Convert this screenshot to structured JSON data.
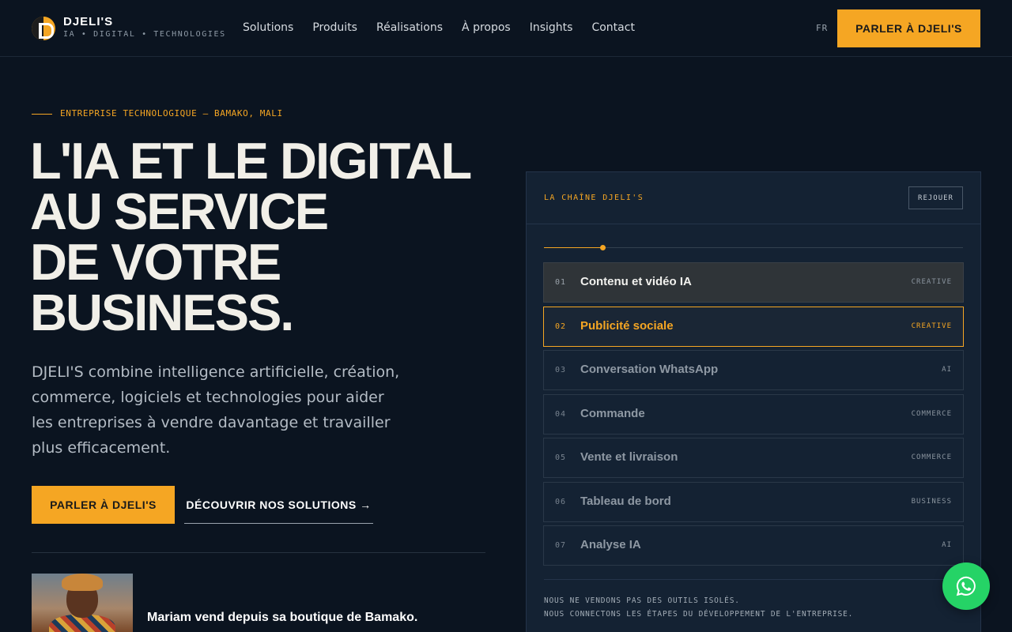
{
  "header": {
    "brand_name": "DJELI'S",
    "brand_tagline": "IA • DIGITAL • TECHNOLOGIES",
    "nav": [
      "Solutions",
      "Produits",
      "Réalisations",
      "À propos",
      "Insights",
      "Contact"
    ],
    "lang": "FR",
    "cta_label": "PARLER À DJELI'S"
  },
  "hero": {
    "eyebrow": "ENTREPRISE TECHNOLOGIQUE — BAMAKO, MALI",
    "title_lines": [
      "L'IA ET LE DIGITAL",
      "AU SERVICE",
      "DE VOTRE",
      "BUSINESS."
    ],
    "description": "DJELI'S combine intelligence artificielle, création, commerce, logiciels et technologies pour aider les entreprises à vendre davantage et travailler plus efficacement.",
    "primary_cta": "PARLER À DJELI'S",
    "secondary_cta": "DÉCOUVRIR NOS SOLUTIONS →",
    "testimonial": "Mariam vend depuis sa boutique de Bamako."
  },
  "chain": {
    "title": "LA CHAÎNE DJELI'S",
    "replay_label": "REJOUER",
    "progress": 0.14,
    "steps": [
      {
        "num": "01",
        "label": "Contenu et vidéo IA",
        "category": "CREATIVE",
        "state": "done"
      },
      {
        "num": "02",
        "label": "Publicité sociale",
        "category": "CREATIVE",
        "state": "active"
      },
      {
        "num": "03",
        "label": "Conversation WhatsApp",
        "category": "AI",
        "state": "pending"
      },
      {
        "num": "04",
        "label": "Commande",
        "category": "COMMERCE",
        "state": "pending"
      },
      {
        "num": "05",
        "label": "Vente et livraison",
        "category": "COMMERCE",
        "state": "pending"
      },
      {
        "num": "06",
        "label": "Tableau de bord",
        "category": "BUSINESS",
        "state": "pending"
      },
      {
        "num": "07",
        "label": "Analyse IA",
        "category": "AI",
        "state": "pending"
      }
    ],
    "note_lines": [
      "NOUS NE VENDONS PAS DES OUTILS ISOLÉS.",
      "NOUS CONNECTONS LES ÉTAPES DU DÉVELOPPEMENT DE L'ENTREPRISE."
    ]
  },
  "icons": {
    "logo": "djelis-logo-icon",
    "whatsapp": "whatsapp-icon"
  },
  "colors": {
    "accent": "#f5a623",
    "background": "#0b1420",
    "panel": "#142233",
    "whatsapp": "#25d366"
  }
}
